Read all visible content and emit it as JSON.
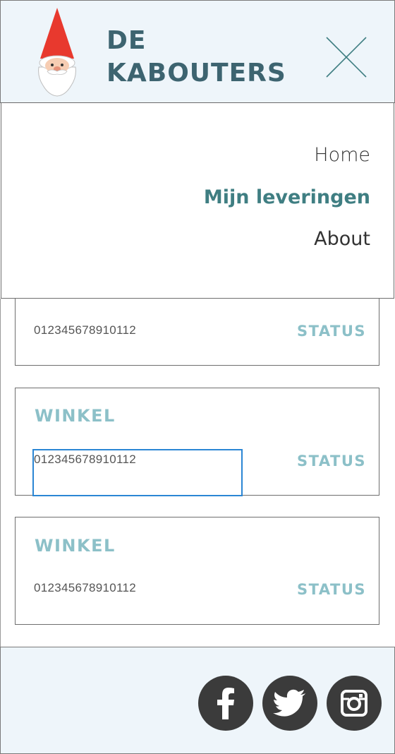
{
  "header": {
    "brand_line1": "DE",
    "brand_line2": "KABOUTERS",
    "logo_icon": "gnome-icon",
    "close_icon": "close-icon"
  },
  "menu": {
    "items": [
      {
        "label": "Home",
        "active": false
      },
      {
        "label": "Mijn leveringen",
        "active": true
      },
      {
        "label": "About",
        "active": false
      }
    ]
  },
  "deliveries": [
    {
      "shop": "",
      "number": "012345678910112",
      "status": "STATUS"
    },
    {
      "shop": "WINKEL",
      "number": "012345678910112",
      "status": "STATUS"
    },
    {
      "shop": "WINKEL",
      "number": "012345678910112",
      "status": "STATUS"
    }
  ],
  "footer": {
    "social": [
      {
        "icon": "facebook-icon"
      },
      {
        "icon": "twitter-icon"
      },
      {
        "icon": "instagram-icon"
      }
    ]
  },
  "colors": {
    "brand": "#3d6470",
    "accent": "#8cc0c8",
    "active_menu": "#3f7e82",
    "header_bg": "#eef5fa",
    "social_bg": "#3b3b3b",
    "focus": "#2b86d4"
  }
}
